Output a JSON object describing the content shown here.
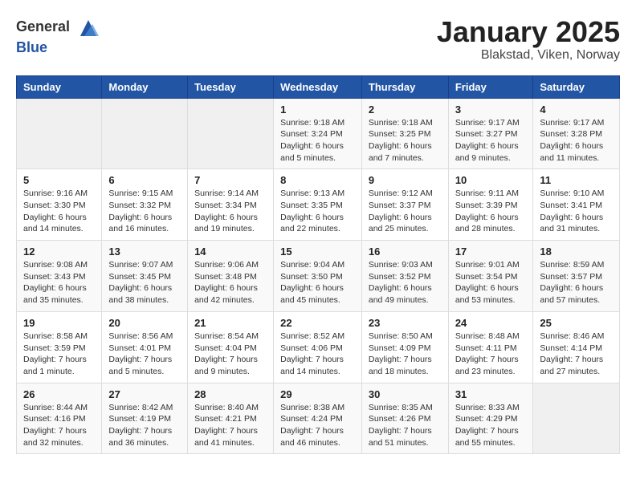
{
  "header": {
    "logo_general": "General",
    "logo_blue": "Blue",
    "title": "January 2025",
    "subtitle": "Blakstad, Viken, Norway"
  },
  "weekdays": [
    "Sunday",
    "Monday",
    "Tuesday",
    "Wednesday",
    "Thursday",
    "Friday",
    "Saturday"
  ],
  "weeks": [
    [
      {
        "day": "",
        "info": ""
      },
      {
        "day": "",
        "info": ""
      },
      {
        "day": "",
        "info": ""
      },
      {
        "day": "1",
        "info": "Sunrise: 9:18 AM\nSunset: 3:24 PM\nDaylight: 6 hours and 5 minutes."
      },
      {
        "day": "2",
        "info": "Sunrise: 9:18 AM\nSunset: 3:25 PM\nDaylight: 6 hours and 7 minutes."
      },
      {
        "day": "3",
        "info": "Sunrise: 9:17 AM\nSunset: 3:27 PM\nDaylight: 6 hours and 9 minutes."
      },
      {
        "day": "4",
        "info": "Sunrise: 9:17 AM\nSunset: 3:28 PM\nDaylight: 6 hours and 11 minutes."
      }
    ],
    [
      {
        "day": "5",
        "info": "Sunrise: 9:16 AM\nSunset: 3:30 PM\nDaylight: 6 hours and 14 minutes."
      },
      {
        "day": "6",
        "info": "Sunrise: 9:15 AM\nSunset: 3:32 PM\nDaylight: 6 hours and 16 minutes."
      },
      {
        "day": "7",
        "info": "Sunrise: 9:14 AM\nSunset: 3:34 PM\nDaylight: 6 hours and 19 minutes."
      },
      {
        "day": "8",
        "info": "Sunrise: 9:13 AM\nSunset: 3:35 PM\nDaylight: 6 hours and 22 minutes."
      },
      {
        "day": "9",
        "info": "Sunrise: 9:12 AM\nSunset: 3:37 PM\nDaylight: 6 hours and 25 minutes."
      },
      {
        "day": "10",
        "info": "Sunrise: 9:11 AM\nSunset: 3:39 PM\nDaylight: 6 hours and 28 minutes."
      },
      {
        "day": "11",
        "info": "Sunrise: 9:10 AM\nSunset: 3:41 PM\nDaylight: 6 hours and 31 minutes."
      }
    ],
    [
      {
        "day": "12",
        "info": "Sunrise: 9:08 AM\nSunset: 3:43 PM\nDaylight: 6 hours and 35 minutes."
      },
      {
        "day": "13",
        "info": "Sunrise: 9:07 AM\nSunset: 3:45 PM\nDaylight: 6 hours and 38 minutes."
      },
      {
        "day": "14",
        "info": "Sunrise: 9:06 AM\nSunset: 3:48 PM\nDaylight: 6 hours and 42 minutes."
      },
      {
        "day": "15",
        "info": "Sunrise: 9:04 AM\nSunset: 3:50 PM\nDaylight: 6 hours and 45 minutes."
      },
      {
        "day": "16",
        "info": "Sunrise: 9:03 AM\nSunset: 3:52 PM\nDaylight: 6 hours and 49 minutes."
      },
      {
        "day": "17",
        "info": "Sunrise: 9:01 AM\nSunset: 3:54 PM\nDaylight: 6 hours and 53 minutes."
      },
      {
        "day": "18",
        "info": "Sunrise: 8:59 AM\nSunset: 3:57 PM\nDaylight: 6 hours and 57 minutes."
      }
    ],
    [
      {
        "day": "19",
        "info": "Sunrise: 8:58 AM\nSunset: 3:59 PM\nDaylight: 7 hours and 1 minute."
      },
      {
        "day": "20",
        "info": "Sunrise: 8:56 AM\nSunset: 4:01 PM\nDaylight: 7 hours and 5 minutes."
      },
      {
        "day": "21",
        "info": "Sunrise: 8:54 AM\nSunset: 4:04 PM\nDaylight: 7 hours and 9 minutes."
      },
      {
        "day": "22",
        "info": "Sunrise: 8:52 AM\nSunset: 4:06 PM\nDaylight: 7 hours and 14 minutes."
      },
      {
        "day": "23",
        "info": "Sunrise: 8:50 AM\nSunset: 4:09 PM\nDaylight: 7 hours and 18 minutes."
      },
      {
        "day": "24",
        "info": "Sunrise: 8:48 AM\nSunset: 4:11 PM\nDaylight: 7 hours and 23 minutes."
      },
      {
        "day": "25",
        "info": "Sunrise: 8:46 AM\nSunset: 4:14 PM\nDaylight: 7 hours and 27 minutes."
      }
    ],
    [
      {
        "day": "26",
        "info": "Sunrise: 8:44 AM\nSunset: 4:16 PM\nDaylight: 7 hours and 32 minutes."
      },
      {
        "day": "27",
        "info": "Sunrise: 8:42 AM\nSunset: 4:19 PM\nDaylight: 7 hours and 36 minutes."
      },
      {
        "day": "28",
        "info": "Sunrise: 8:40 AM\nSunset: 4:21 PM\nDaylight: 7 hours and 41 minutes."
      },
      {
        "day": "29",
        "info": "Sunrise: 8:38 AM\nSunset: 4:24 PM\nDaylight: 7 hours and 46 minutes."
      },
      {
        "day": "30",
        "info": "Sunrise: 8:35 AM\nSunset: 4:26 PM\nDaylight: 7 hours and 51 minutes."
      },
      {
        "day": "31",
        "info": "Sunrise: 8:33 AM\nSunset: 4:29 PM\nDaylight: 7 hours and 55 minutes."
      },
      {
        "day": "",
        "info": ""
      }
    ]
  ]
}
